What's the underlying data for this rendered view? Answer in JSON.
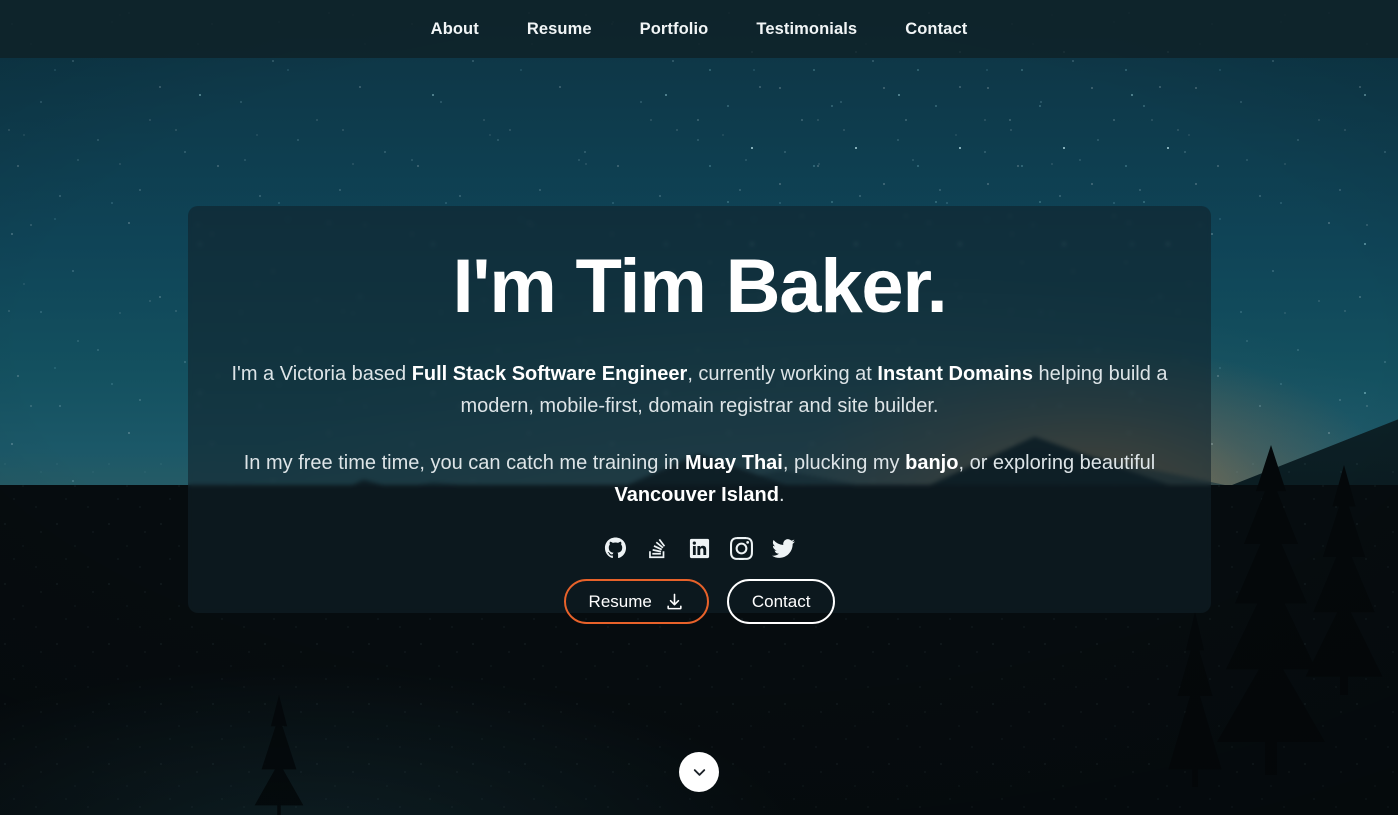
{
  "nav": {
    "items": [
      {
        "label": "About",
        "name": "nav-link-about"
      },
      {
        "label": "Resume",
        "name": "nav-link-resume"
      },
      {
        "label": "Portfolio",
        "name": "nav-link-portfolio"
      },
      {
        "label": "Testimonials",
        "name": "nav-link-testimonials"
      },
      {
        "label": "Contact",
        "name": "nav-link-contact"
      }
    ]
  },
  "hero": {
    "title": "I'm Tim Baker.",
    "paragraph_one": {
      "segments": [
        {
          "text": "I'm a Victoria based ",
          "bold": false
        },
        {
          "text": "Full Stack Software Engineer",
          "bold": true
        },
        {
          "text": ", currently working at ",
          "bold": false
        },
        {
          "text": "Instant Domains",
          "bold": true
        },
        {
          "text": " helping build a modern, mobile-first, domain registrar and site builder.",
          "bold": false
        }
      ],
      "plain": "I'm a Victoria based Full Stack Software Engineer, currently working at Instant Domains helping build a modern, mobile-first, domain registrar and site builder."
    },
    "paragraph_two": {
      "segments": [
        {
          "text": "In my free time time, you can catch me training in ",
          "bold": false
        },
        {
          "text": "Muay Thai",
          "bold": true
        },
        {
          "text": ", plucking my ",
          "bold": false
        },
        {
          "text": "banjo",
          "bold": true
        },
        {
          "text": ", or exploring beautiful ",
          "bold": false
        },
        {
          "text": "Vancouver Island",
          "bold": true
        },
        {
          "text": ".",
          "bold": false
        }
      ],
      "plain": "In my free time time, you can catch me training in Muay Thai, plucking my banjo, or exploring beautiful Vancouver Island."
    },
    "socials": [
      {
        "icon": "github-icon",
        "label": "GitHub"
      },
      {
        "icon": "stack-overflow-icon",
        "label": "Stack Overflow"
      },
      {
        "icon": "linkedin-icon",
        "label": "LinkedIn"
      },
      {
        "icon": "instagram-icon",
        "label": "Instagram"
      },
      {
        "icon": "twitter-icon",
        "label": "Twitter"
      }
    ],
    "buttons": {
      "resume": {
        "label": "Resume",
        "icon": "download-icon"
      },
      "contact": {
        "label": "Contact"
      }
    }
  },
  "scroll_indicator": {
    "icon": "chevron-down-icon"
  },
  "colors": {
    "accent": "#e8622a",
    "nav_background": "#0f242a",
    "card_background": "rgba(17,32,42,0.58)",
    "text_primary": "#ffffff",
    "text_body": "#dde4e7",
    "scroll_button": "#ffffff"
  }
}
